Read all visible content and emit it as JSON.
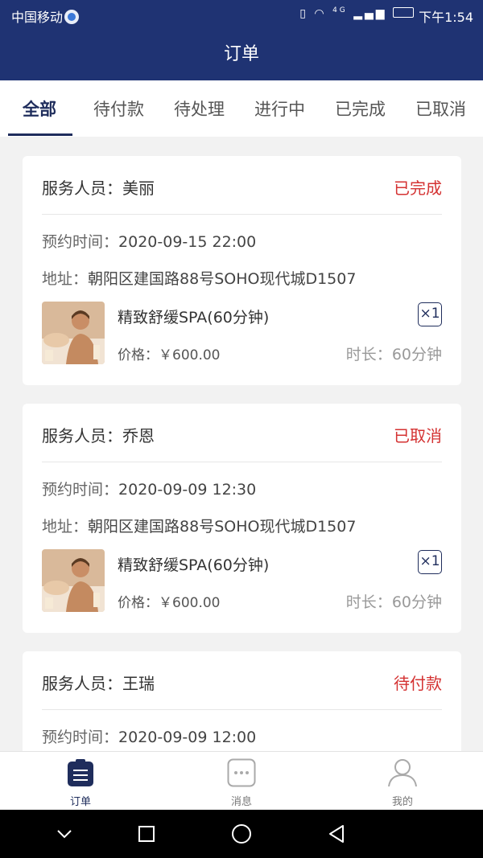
{
  "status_bar": {
    "carrier": "中国移动",
    "network": "4G",
    "time": "下午1:54"
  },
  "header": {
    "title": "订单"
  },
  "tabs": [
    {
      "label": "全部",
      "active": true
    },
    {
      "label": "待付款",
      "active": false
    },
    {
      "label": "待处理",
      "active": false
    },
    {
      "label": "进行中",
      "active": false
    },
    {
      "label": "已完成",
      "active": false
    },
    {
      "label": "已取消",
      "active": false
    }
  ],
  "orders": [
    {
      "staff_label": "服务人员：",
      "staff_name": "美丽",
      "status": "已完成",
      "time_label": "预约时间：",
      "time": "2020-09-15 22:00",
      "addr_label": "地址：",
      "address": "朝阳区建国路88号SOHO现代城D1507",
      "service_name": "精致舒缓SPA(60分钟)",
      "quantity": "×1",
      "price_label": "价格：",
      "price": "￥600.00",
      "duration_label": "时长：",
      "duration": "60分钟"
    },
    {
      "staff_label": "服务人员：",
      "staff_name": "乔恩",
      "status": "已取消",
      "time_label": "预约时间：",
      "time": "2020-09-09 12:30",
      "addr_label": "地址：",
      "address": "朝阳区建国路88号SOHO现代城D1507",
      "service_name": "精致舒缓SPA(60分钟)",
      "quantity": "×1",
      "price_label": "价格：",
      "price": "￥600.00",
      "duration_label": "时长：",
      "duration": "60分钟"
    },
    {
      "staff_label": "服务人员：",
      "staff_name": "王瑞",
      "status": "待付款",
      "time_label": "预约时间：",
      "time": "2020-09-09 12:00"
    }
  ],
  "bottom_nav": [
    {
      "label": "订单",
      "icon": "clipboard-list-icon",
      "active": true
    },
    {
      "label": "消息",
      "icon": "chat-bubble-icon",
      "active": false
    },
    {
      "label": "我的",
      "icon": "user-icon",
      "active": false
    }
  ],
  "colors": {
    "primary": "#1f3373",
    "accent_dark": "#1f2d5c",
    "status_red": "#d43232",
    "background": "#f2f2f2"
  }
}
